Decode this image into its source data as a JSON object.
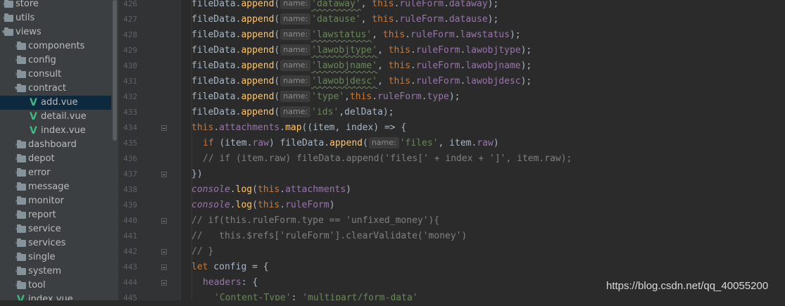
{
  "project_tree": [
    {
      "label": "store",
      "type": "folder",
      "level": 0,
      "expanded": false,
      "selected": false
    },
    {
      "label": "utils",
      "type": "folder",
      "level": 0,
      "expanded": false,
      "selected": false
    },
    {
      "label": "views",
      "type": "folder",
      "level": 0,
      "expanded": true,
      "selected": false
    },
    {
      "label": "components",
      "type": "folder",
      "level": 1,
      "expanded": false,
      "selected": false
    },
    {
      "label": "config",
      "type": "folder",
      "level": 1,
      "expanded": false,
      "selected": false
    },
    {
      "label": "consult",
      "type": "folder",
      "level": 1,
      "expanded": false,
      "selected": false
    },
    {
      "label": "contract",
      "type": "folder",
      "level": 1,
      "expanded": true,
      "selected": false
    },
    {
      "label": "add.vue",
      "type": "vue",
      "level": 2,
      "expanded": false,
      "selected": true
    },
    {
      "label": "detail.vue",
      "type": "vue",
      "level": 2,
      "expanded": false,
      "selected": false
    },
    {
      "label": "index.vue",
      "type": "vue",
      "level": 2,
      "expanded": false,
      "selected": false
    },
    {
      "label": "dashboard",
      "type": "folder",
      "level": 1,
      "expanded": false,
      "selected": false
    },
    {
      "label": "depot",
      "type": "folder",
      "level": 1,
      "expanded": false,
      "selected": false
    },
    {
      "label": "error",
      "type": "folder",
      "level": 1,
      "expanded": false,
      "selected": false
    },
    {
      "label": "message",
      "type": "folder",
      "level": 1,
      "expanded": false,
      "selected": false
    },
    {
      "label": "monitor",
      "type": "folder",
      "level": 1,
      "expanded": false,
      "selected": false
    },
    {
      "label": "report",
      "type": "folder",
      "level": 1,
      "expanded": false,
      "selected": false
    },
    {
      "label": "service",
      "type": "folder",
      "level": 1,
      "expanded": false,
      "selected": false
    },
    {
      "label": "services",
      "type": "folder",
      "level": 1,
      "expanded": false,
      "selected": false
    },
    {
      "label": "single",
      "type": "folder",
      "level": 1,
      "expanded": false,
      "selected": false
    },
    {
      "label": "system",
      "type": "folder",
      "level": 1,
      "expanded": false,
      "selected": false
    },
    {
      "label": "tool",
      "type": "folder",
      "level": 1,
      "expanded": false,
      "selected": false
    },
    {
      "label": "index.vue",
      "type": "vue",
      "level": 1,
      "expanded": false,
      "selected": false
    }
  ],
  "code_lines": [
    {
      "num": "426",
      "fold": false,
      "indent": 1,
      "tokens": [
        [
          "fileData.",
          "txt"
        ],
        [
          "append",
          "fn"
        ],
        [
          "(",
          "txt"
        ],
        [
          "name:",
          "hint"
        ],
        [
          "'dataway'",
          "str-sq"
        ],
        [
          ", ",
          "txt"
        ],
        [
          "this",
          "kw"
        ],
        [
          ".",
          "txt"
        ],
        [
          "ruleForm",
          "prop"
        ],
        [
          ".",
          "txt"
        ],
        [
          "dataway",
          "prop"
        ],
        [
          ");",
          "txt"
        ]
      ]
    },
    {
      "num": "427",
      "fold": false,
      "indent": 1,
      "tokens": [
        [
          "fileData.",
          "txt"
        ],
        [
          "append",
          "fn"
        ],
        [
          "(",
          "txt"
        ],
        [
          "name:",
          "hint"
        ],
        [
          "'datause'",
          "str"
        ],
        [
          ", ",
          "txt"
        ],
        [
          "this",
          "kw"
        ],
        [
          ".",
          "txt"
        ],
        [
          "ruleForm",
          "prop"
        ],
        [
          ".",
          "txt"
        ],
        [
          "datause",
          "prop"
        ],
        [
          ");",
          "txt"
        ]
      ]
    },
    {
      "num": "428",
      "fold": false,
      "indent": 1,
      "tokens": [
        [
          "fileData.",
          "txt"
        ],
        [
          "append",
          "fn"
        ],
        [
          "(",
          "txt"
        ],
        [
          "name:",
          "hint"
        ],
        [
          "'lawstatus'",
          "str-sq"
        ],
        [
          ", ",
          "txt"
        ],
        [
          "this",
          "kw"
        ],
        [
          ".",
          "txt"
        ],
        [
          "ruleForm",
          "prop"
        ],
        [
          ".",
          "txt"
        ],
        [
          "lawstatus",
          "prop"
        ],
        [
          ");",
          "txt"
        ]
      ]
    },
    {
      "num": "429",
      "fold": false,
      "indent": 1,
      "tokens": [
        [
          "fileData.",
          "txt"
        ],
        [
          "append",
          "fn"
        ],
        [
          "(",
          "txt"
        ],
        [
          "name:",
          "hint"
        ],
        [
          "'lawobjtype'",
          "str-sq"
        ],
        [
          ", ",
          "txt"
        ],
        [
          "this",
          "kw"
        ],
        [
          ".",
          "txt"
        ],
        [
          "ruleForm",
          "prop"
        ],
        [
          ".",
          "txt"
        ],
        [
          "lawobjtype",
          "prop"
        ],
        [
          ");",
          "txt"
        ]
      ]
    },
    {
      "num": "430",
      "fold": false,
      "indent": 1,
      "tokens": [
        [
          "fileData.",
          "txt"
        ],
        [
          "append",
          "fn"
        ],
        [
          "(",
          "txt"
        ],
        [
          "name:",
          "hint"
        ],
        [
          "'lawobjname'",
          "str-sq"
        ],
        [
          ", ",
          "txt"
        ],
        [
          "this",
          "kw"
        ],
        [
          ".",
          "txt"
        ],
        [
          "ruleForm",
          "prop"
        ],
        [
          ".",
          "txt"
        ],
        [
          "lawobjname",
          "prop"
        ],
        [
          ");",
          "txt"
        ]
      ]
    },
    {
      "num": "431",
      "fold": false,
      "indent": 1,
      "tokens": [
        [
          "fileData.",
          "txt"
        ],
        [
          "append",
          "fn"
        ],
        [
          "(",
          "txt"
        ],
        [
          "name:",
          "hint"
        ],
        [
          "'lawobjdesc'",
          "str-sq"
        ],
        [
          ", ",
          "txt"
        ],
        [
          "this",
          "kw"
        ],
        [
          ".",
          "txt"
        ],
        [
          "ruleForm",
          "prop"
        ],
        [
          ".",
          "txt"
        ],
        [
          "lawobjdesc",
          "prop"
        ],
        [
          ");",
          "txt"
        ]
      ]
    },
    {
      "num": "432",
      "fold": false,
      "indent": 1,
      "tokens": [
        [
          "fileData.",
          "txt"
        ],
        [
          "append",
          "fn"
        ],
        [
          "(",
          "txt"
        ],
        [
          "name:",
          "hint"
        ],
        [
          "'type'",
          "str"
        ],
        [
          ",",
          "txt"
        ],
        [
          "this",
          "kw"
        ],
        [
          ".",
          "txt"
        ],
        [
          "ruleForm",
          "prop"
        ],
        [
          ".",
          "txt"
        ],
        [
          "type",
          "prop"
        ],
        [
          ");",
          "txt"
        ]
      ]
    },
    {
      "num": "433",
      "fold": false,
      "indent": 1,
      "tokens": [
        [
          "fileData.",
          "txt"
        ],
        [
          "append",
          "fn"
        ],
        [
          "(",
          "txt"
        ],
        [
          "name:",
          "hint"
        ],
        [
          "'ids'",
          "str"
        ],
        [
          ",delData);",
          "txt"
        ]
      ]
    },
    {
      "num": "434",
      "fold": true,
      "indent": 1,
      "tokens": [
        [
          "this",
          "kw"
        ],
        [
          ".",
          "txt"
        ],
        [
          "attachments",
          "prop"
        ],
        [
          ".",
          "txt"
        ],
        [
          "map",
          "fn"
        ],
        [
          "((item, index) => {",
          "txt"
        ]
      ]
    },
    {
      "num": "435",
      "fold": false,
      "indent": 2,
      "tokens": [
        [
          "if",
          "kw"
        ],
        [
          " (item.",
          "txt"
        ],
        [
          "raw",
          "prop"
        ],
        [
          ") fileData.",
          "txt"
        ],
        [
          "append",
          "fn"
        ],
        [
          "(",
          "txt"
        ],
        [
          "name:",
          "hint"
        ],
        [
          "'files'",
          "str"
        ],
        [
          ", item.",
          "txt"
        ],
        [
          "raw",
          "prop"
        ],
        [
          ")",
          "txt"
        ]
      ]
    },
    {
      "num": "436",
      "fold": false,
      "indent": 2,
      "tokens": [
        [
          "// if (item.raw) fileData.append('files[' + index + ']', item.raw);",
          "com"
        ]
      ]
    },
    {
      "num": "437",
      "fold": true,
      "indent": 1,
      "tokens": [
        [
          "})",
          "txt"
        ]
      ]
    },
    {
      "num": "438",
      "fold": false,
      "indent": 1,
      "tokens": [
        [
          "console",
          "con"
        ],
        [
          ".",
          "txt"
        ],
        [
          "log",
          "fn"
        ],
        [
          "(",
          "txt"
        ],
        [
          "this",
          "kw"
        ],
        [
          ".",
          "txt"
        ],
        [
          "attachments",
          "prop"
        ],
        [
          ")",
          "txt"
        ]
      ]
    },
    {
      "num": "439",
      "fold": false,
      "indent": 1,
      "tokens": [
        [
          "console",
          "con"
        ],
        [
          ".",
          "txt"
        ],
        [
          "log",
          "fn"
        ],
        [
          "(",
          "txt"
        ],
        [
          "this",
          "kw"
        ],
        [
          ".",
          "txt"
        ],
        [
          "ruleForm",
          "prop"
        ],
        [
          ")",
          "txt"
        ]
      ]
    },
    {
      "num": "440",
      "fold": true,
      "indent": 1,
      "tokens": [
        [
          "// if(this.ruleForm.type == 'unfixed_money'){",
          "com"
        ]
      ]
    },
    {
      "num": "441",
      "fold": false,
      "indent": 1,
      "tokens": [
        [
          "//   this.$refs['ruleForm'].clearValidate('money')",
          "com"
        ]
      ]
    },
    {
      "num": "442",
      "fold": true,
      "indent": 1,
      "tokens": [
        [
          "// }",
          "com"
        ]
      ]
    },
    {
      "num": "443",
      "fold": true,
      "indent": 1,
      "tokens": [
        [
          "let",
          "kw"
        ],
        [
          " config = {",
          "txt"
        ]
      ]
    },
    {
      "num": "444",
      "fold": true,
      "indent": 2,
      "tokens": [
        [
          "headers",
          "prop"
        ],
        [
          ": {",
          "txt"
        ]
      ]
    },
    {
      "num": "445",
      "fold": false,
      "indent": 3,
      "tokens": [
        [
          "'Content-Type'",
          "str"
        ],
        [
          ": ",
          "txt"
        ],
        [
          "'multipart/form-data'",
          "str"
        ]
      ]
    }
  ],
  "watermark": "https://blog.csdn.net/qq_40055200",
  "colors": {
    "editor_bg": "#2b2b2b",
    "gutter_bg": "#313335",
    "tree_bg": "#3c3f41",
    "selection": "#0d293e",
    "string": "#6a8759",
    "keyword": "#cc7832",
    "function": "#ffc66d",
    "property": "#9876aa",
    "comment": "#808080",
    "text": "#a9b7c6"
  },
  "icons": {
    "folder": "folder-icon",
    "vue": "vue-file-icon",
    "collapsed": "chevron-right-icon",
    "expanded": "chevron-down-icon"
  }
}
